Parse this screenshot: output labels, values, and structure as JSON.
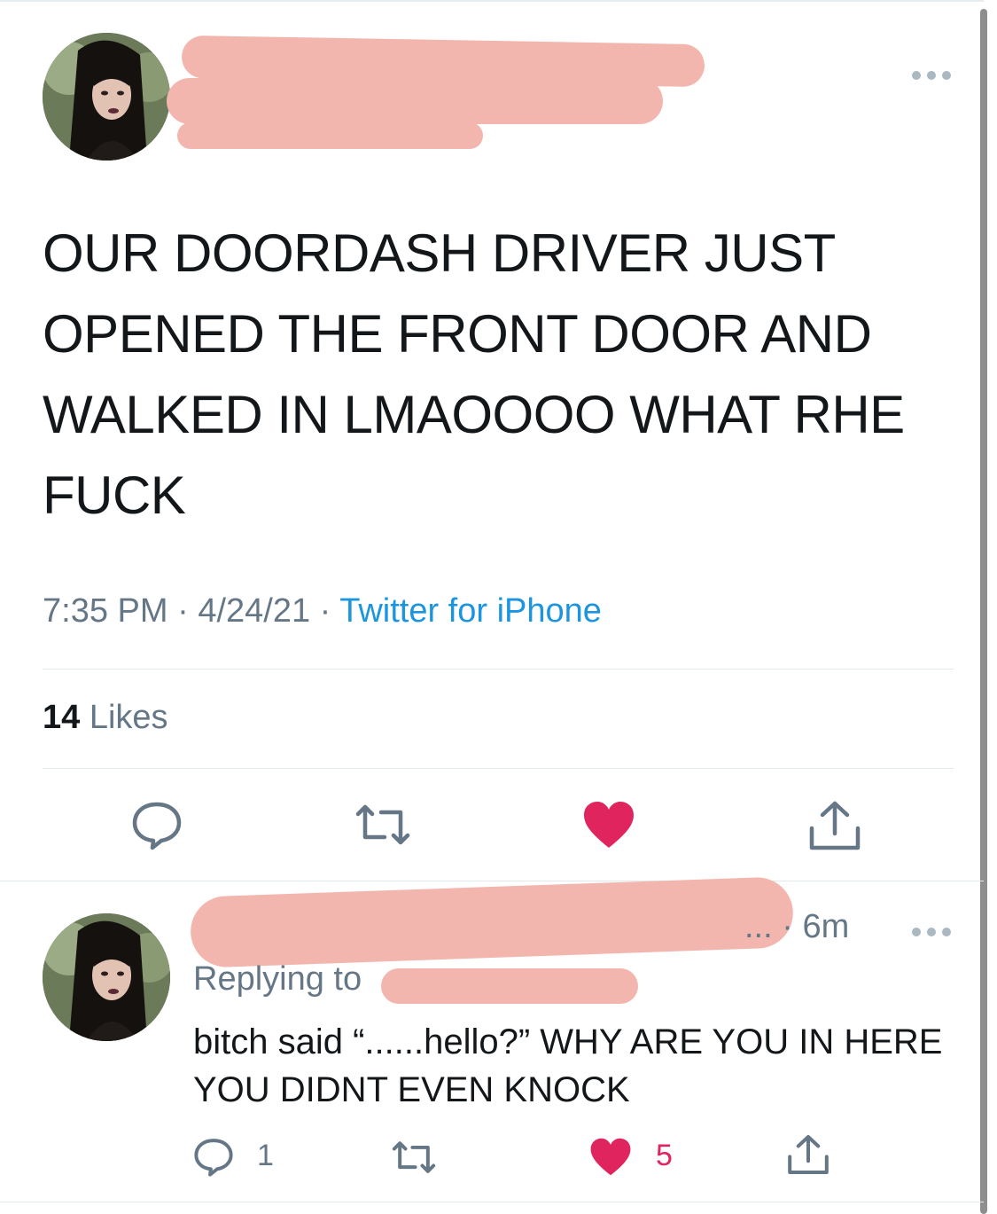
{
  "tweet": {
    "text": "OUR DOORDASH DRIVER JUST OPENED THE FRONT DOOR AND WALKED IN LMAOOOO WHAT RHE FUCK",
    "time": "7:35 PM",
    "date": "4/24/21",
    "separator": " · ",
    "source": "Twitter for iPhone",
    "likes_count": "14",
    "likes_label": "Likes",
    "liked": true,
    "like_color": "#e0245e"
  },
  "reply": {
    "handle_tail": "... · 6m",
    "replying_to_label": "Replying to",
    "text": "bitch said “......hello?” WHY ARE YOU IN HERE YOU DIDNT EVEN KNOCK",
    "reply_count": "1",
    "like_count": "5",
    "liked": true
  },
  "colors": {
    "link": "#1b95e0",
    "muted": "#657786",
    "redaction": "#f3b6ae"
  },
  "icons": {
    "more": "more-horizontal-icon",
    "reply": "speech-bubble-icon",
    "retweet": "retweet-icon",
    "like": "heart-icon",
    "share": "share-icon"
  }
}
